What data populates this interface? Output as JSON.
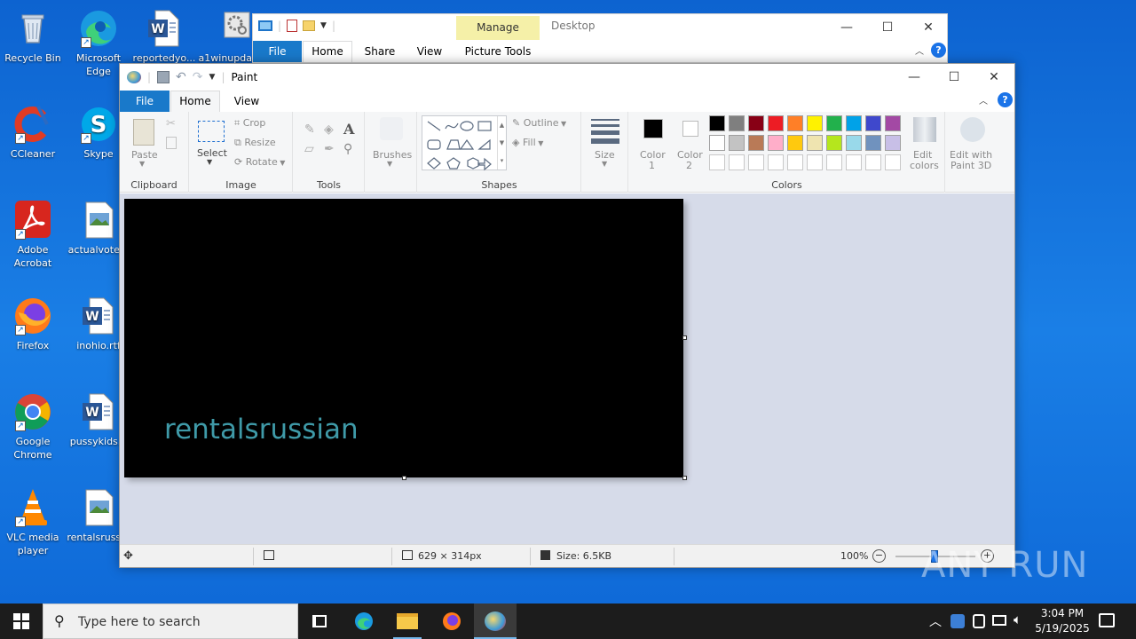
{
  "desktop": {
    "icons": [
      {
        "label": "Recycle Bin"
      },
      {
        "label": "Microsoft Edge"
      },
      {
        "label": "reportedyo..."
      },
      {
        "label": "a1winupda..."
      },
      {
        "label": "CCleaner"
      },
      {
        "label": "Skype"
      },
      {
        "label": "Adobe Acrobat"
      },
      {
        "label": "actualvote..."
      },
      {
        "label": "Firefox"
      },
      {
        "label": "inohio.rtf"
      },
      {
        "label": "Google Chrome"
      },
      {
        "label": "pussykids..."
      },
      {
        "label": "VLC media player"
      },
      {
        "label": "rentalsruss..."
      }
    ]
  },
  "explorer": {
    "title": "Desktop",
    "contextual_tab_group": "Manage",
    "tabs": [
      "File",
      "Home",
      "Share",
      "View",
      "Picture Tools"
    ]
  },
  "paint": {
    "title": "Paint",
    "tabs": [
      "File",
      "Home",
      "View"
    ],
    "ribbon": {
      "clipboard": {
        "paste": "Paste",
        "group": "Clipboard"
      },
      "image": {
        "select": "Select",
        "crop": "Crop",
        "resize": "Resize",
        "rotate": "Rotate",
        "group": "Image"
      },
      "tools": {
        "group": "Tools"
      },
      "brushes": {
        "label": "Brushes"
      },
      "shapes": {
        "outline": "Outline",
        "fill": "Fill",
        "group": "Shapes"
      },
      "size": {
        "label": "Size"
      },
      "colors": {
        "color1": "Color",
        "color1_num": "1",
        "color2": "Color",
        "color2_num": "2",
        "edit": "Edit",
        "edit2": "colors",
        "paint3d": "Edit with",
        "paint3d2": "Paint 3D",
        "group": "Colors",
        "palette_row1": [
          "#000000",
          "#7f7f7f",
          "#880015",
          "#ed1c24",
          "#ff7f27",
          "#fff200",
          "#22b14c",
          "#00a2e8",
          "#3f48cc",
          "#a349a4"
        ],
        "palette_row2": [
          "#ffffff",
          "#c3c3c3",
          "#b97a57",
          "#ffaec9",
          "#ffc90e",
          "#efe4b0",
          "#b5e61d",
          "#99d9ea",
          "#7092be",
          "#c8bfe7"
        ]
      }
    },
    "canvas": {
      "text": "rentalsrussian",
      "text_color": "#3f9aa8",
      "bg": "#000000"
    },
    "status": {
      "dimensions": "629 × 314px",
      "size": "Size: 6.5KB",
      "zoom": "100%"
    }
  },
  "taskbar": {
    "search_placeholder": "Type here to search",
    "time": "3:04 PM",
    "date": "5/19/2025"
  },
  "watermark": "ANY RUN"
}
